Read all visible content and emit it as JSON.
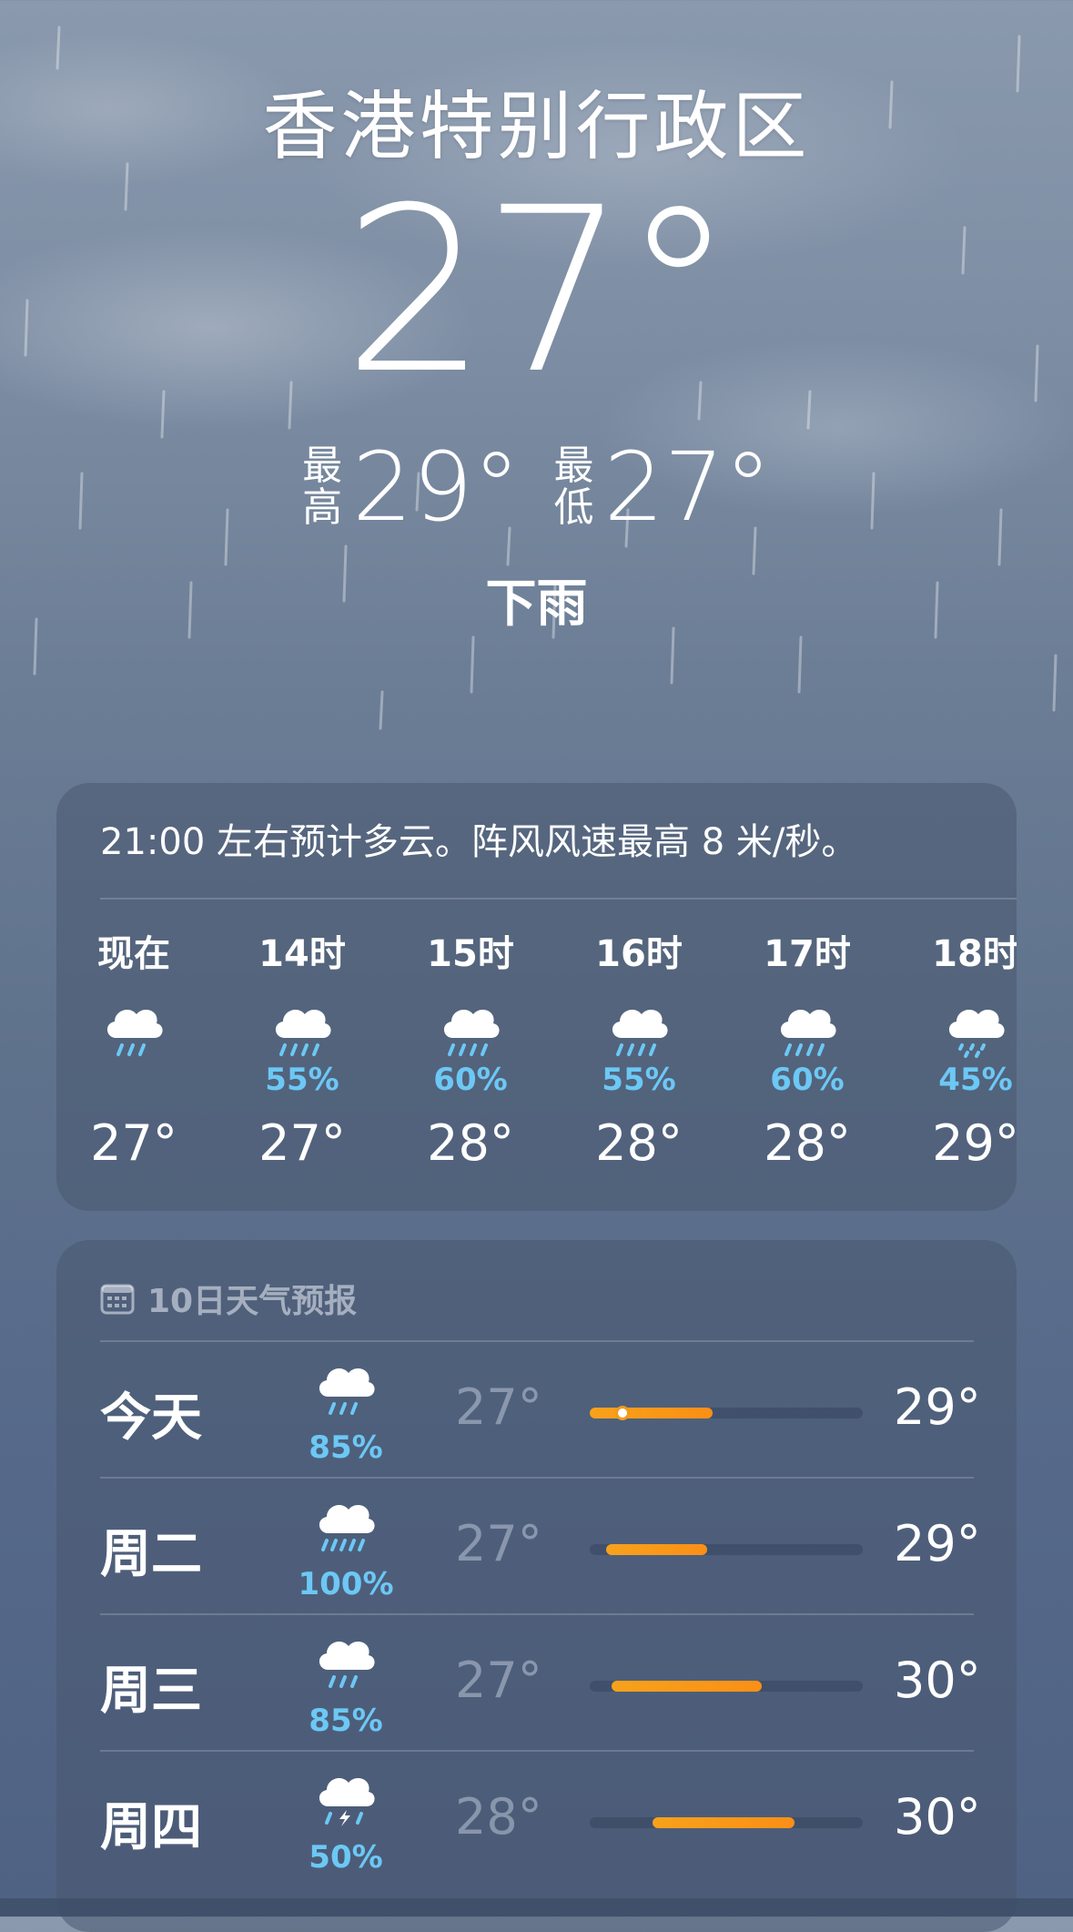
{
  "location": {
    "city": "香港特别行政区",
    "current_temp": "27°",
    "high_label": "最高",
    "high_temp": "29°",
    "low_label": "最低",
    "low_temp": "27°",
    "condition": "下雨"
  },
  "hourly": {
    "summary": "21:00 左右预计多云。阵风风速最高 8 米/秒。",
    "items": [
      {
        "label": "现在",
        "icon": "cloud-rain-icon",
        "prob": "",
        "temp": "27°"
      },
      {
        "label": "14时",
        "icon": "cloud-rain-icon",
        "prob": "55%",
        "temp": "27°"
      },
      {
        "label": "15时",
        "icon": "cloud-rain-icon",
        "prob": "60%",
        "temp": "28°"
      },
      {
        "label": "16时",
        "icon": "cloud-rain-icon",
        "prob": "55%",
        "temp": "28°"
      },
      {
        "label": "17时",
        "icon": "cloud-rain-icon",
        "prob": "60%",
        "temp": "28°"
      },
      {
        "label": "18时",
        "icon": "cloud-drizzle-icon",
        "prob": "45%",
        "temp": "29°"
      }
    ]
  },
  "daily": {
    "header": "10日天气预报",
    "days": [
      {
        "name": "今天",
        "icon": "cloud-rain-icon",
        "prob": "85%",
        "low": "27°",
        "high": "29°",
        "bar_start": 0.0,
        "bar_end": 0.45,
        "current_marker": 0.12
      },
      {
        "name": "周二",
        "icon": "cloud-heavy-rain-icon",
        "prob": "100%",
        "low": "27°",
        "high": "29°",
        "bar_start": 0.06,
        "bar_end": 0.43
      },
      {
        "name": "周三",
        "icon": "cloud-rain-icon",
        "prob": "85%",
        "low": "27°",
        "high": "30°",
        "bar_start": 0.08,
        "bar_end": 0.63
      },
      {
        "name": "周四",
        "icon": "cloud-bolt-rain-icon",
        "prob": "50%",
        "low": "28°",
        "high": "30°",
        "bar_start": 0.23,
        "bar_end": 0.75
      }
    ]
  },
  "colors": {
    "precip": "#6cc8f5",
    "bar": "#fb8f16"
  }
}
